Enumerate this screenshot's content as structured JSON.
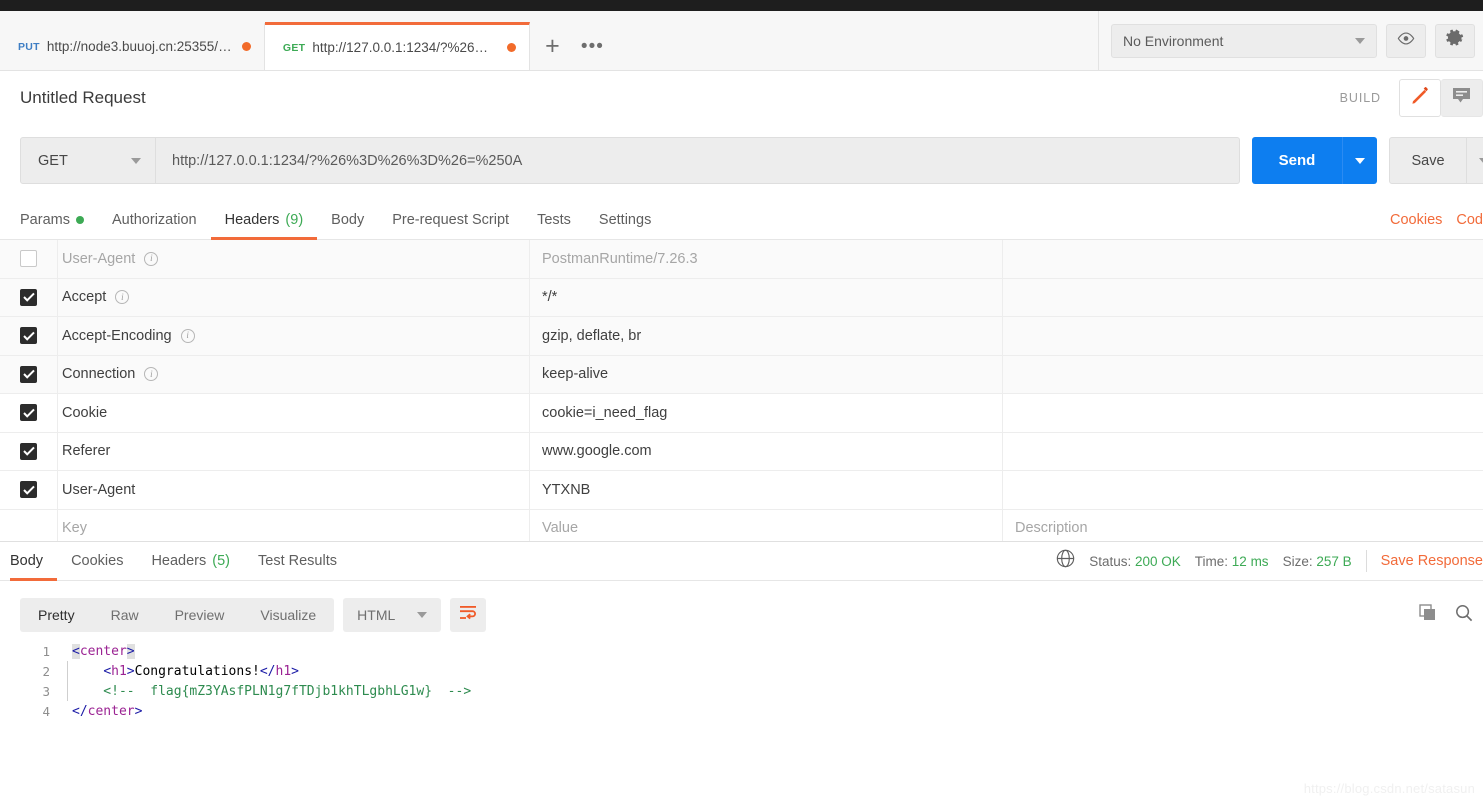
{
  "window": {
    "title_strip_color": "#1e1e1e"
  },
  "tabs": {
    "items": [
      {
        "method": "PUT",
        "url": "http://node3.buuoj.cn:25355/h...",
        "unsaved": true,
        "active": false
      },
      {
        "method": "GET",
        "url": "http://127.0.0.1:1234/?%26%3D...",
        "unsaved": true,
        "active": true
      }
    ],
    "add_label": "+",
    "more_label": "•••"
  },
  "environment": {
    "selected": "No Environment",
    "eye_icon": "eye-icon",
    "settings_icon": "gear-icon"
  },
  "request": {
    "title": "Untitled Request",
    "build_label": "BUILD",
    "edit_icon": "pencil-icon",
    "comment_icon": "comment-icon",
    "method": "GET",
    "url": "http://127.0.0.1:1234/?%26%3D%26%3D%26=%250A",
    "send_label": "Send",
    "save_label": "Save",
    "tabs": [
      {
        "label": "Params",
        "dot": true,
        "count": "",
        "active": false
      },
      {
        "label": "Authorization",
        "dot": false,
        "count": "",
        "active": false
      },
      {
        "label": "Headers",
        "dot": false,
        "count": "(9)",
        "active": true
      },
      {
        "label": "Body",
        "dot": false,
        "count": "",
        "active": false
      },
      {
        "label": "Pre-request Script",
        "dot": false,
        "count": "",
        "active": false
      },
      {
        "label": "Tests",
        "dot": false,
        "count": "",
        "active": false
      },
      {
        "label": "Settings",
        "dot": false,
        "count": "",
        "active": false
      }
    ],
    "links": [
      "Cookies",
      "Cod"
    ]
  },
  "headers_table": {
    "placeholder_row": {
      "key": "Key",
      "value": "Value",
      "description": "Description"
    },
    "rows": [
      {
        "checked": false,
        "auto": true,
        "muted": true,
        "info": true,
        "key": "User-Agent",
        "value": "PostmanRuntime/7.26.3",
        "description": ""
      },
      {
        "checked": true,
        "auto": true,
        "muted": false,
        "info": true,
        "key": "Accept",
        "value": "*/*",
        "description": ""
      },
      {
        "checked": true,
        "auto": true,
        "muted": false,
        "info": true,
        "key": "Accept-Encoding",
        "value": "gzip, deflate, br",
        "description": ""
      },
      {
        "checked": true,
        "auto": true,
        "muted": false,
        "info": true,
        "key": "Connection",
        "value": "keep-alive",
        "description": ""
      },
      {
        "checked": true,
        "auto": false,
        "muted": false,
        "info": false,
        "key": "Cookie",
        "value": "cookie=i_need_flag",
        "description": ""
      },
      {
        "checked": true,
        "auto": false,
        "muted": false,
        "info": false,
        "key": "Referer",
        "value": "www.google.com",
        "description": ""
      },
      {
        "checked": true,
        "auto": false,
        "muted": false,
        "info": false,
        "key": "User-Agent",
        "value": "YTXNB",
        "description": ""
      }
    ]
  },
  "response": {
    "tabs": [
      {
        "label": "Body",
        "count": "",
        "active": true
      },
      {
        "label": "Cookies",
        "count": "",
        "active": false
      },
      {
        "label": "Headers",
        "count": "(5)",
        "active": false
      },
      {
        "label": "Test Results",
        "count": "",
        "active": false
      }
    ],
    "globe_icon": "globe-icon",
    "status_label": "Status:",
    "status_value": "200 OK",
    "time_label": "Time:",
    "time_value": "12 ms",
    "size_label": "Size:",
    "size_value": "257 B",
    "save_response": "Save Response",
    "view_modes": [
      {
        "label": "Pretty",
        "active": true
      },
      {
        "label": "Raw",
        "active": false
      },
      {
        "label": "Preview",
        "active": false
      },
      {
        "label": "Visualize",
        "active": false
      }
    ],
    "format": "HTML",
    "wrap_icon": "word-wrap-icon",
    "copy_icon": "copy-icon",
    "search_icon": "search-icon",
    "code_lines": [
      {
        "n": "1",
        "segments": [
          {
            "t": "<",
            "c": "tag hl"
          },
          {
            "t": "center",
            "c": "tagname"
          },
          {
            "t": ">",
            "c": "tag hl"
          }
        ]
      },
      {
        "n": "2",
        "segments": [
          {
            "t": "    ",
            "c": ""
          },
          {
            "t": "<",
            "c": "tag"
          },
          {
            "t": "h1",
            "c": "tagname"
          },
          {
            "t": ">",
            "c": "tag"
          },
          {
            "t": "Congratulations!",
            "c": ""
          },
          {
            "t": "</",
            "c": "tag"
          },
          {
            "t": "h1",
            "c": "tagname"
          },
          {
            "t": ">",
            "c": "tag"
          }
        ]
      },
      {
        "n": "3",
        "segments": [
          {
            "t": "    ",
            "c": ""
          },
          {
            "t": "<!--  flag{mZ3YAsfPLN1g7fTDjb1khTLgbhLG1w}  -->",
            "c": "comment"
          }
        ]
      },
      {
        "n": "4",
        "segments": [
          {
            "t": "</",
            "c": "tag"
          },
          {
            "t": "center",
            "c": "tagname"
          },
          {
            "t": ">",
            "c": "tag"
          }
        ]
      }
    ],
    "flag": "flag{mZ3YAsfPLN1g7fTDjb1khTLgbhLG1w}"
  },
  "watermark": "https://blog.csdn.net/satasun",
  "colors": {
    "accent_orange": "#f26b3a",
    "send_blue": "#0d7ef0",
    "success_green": "#3daa55"
  }
}
